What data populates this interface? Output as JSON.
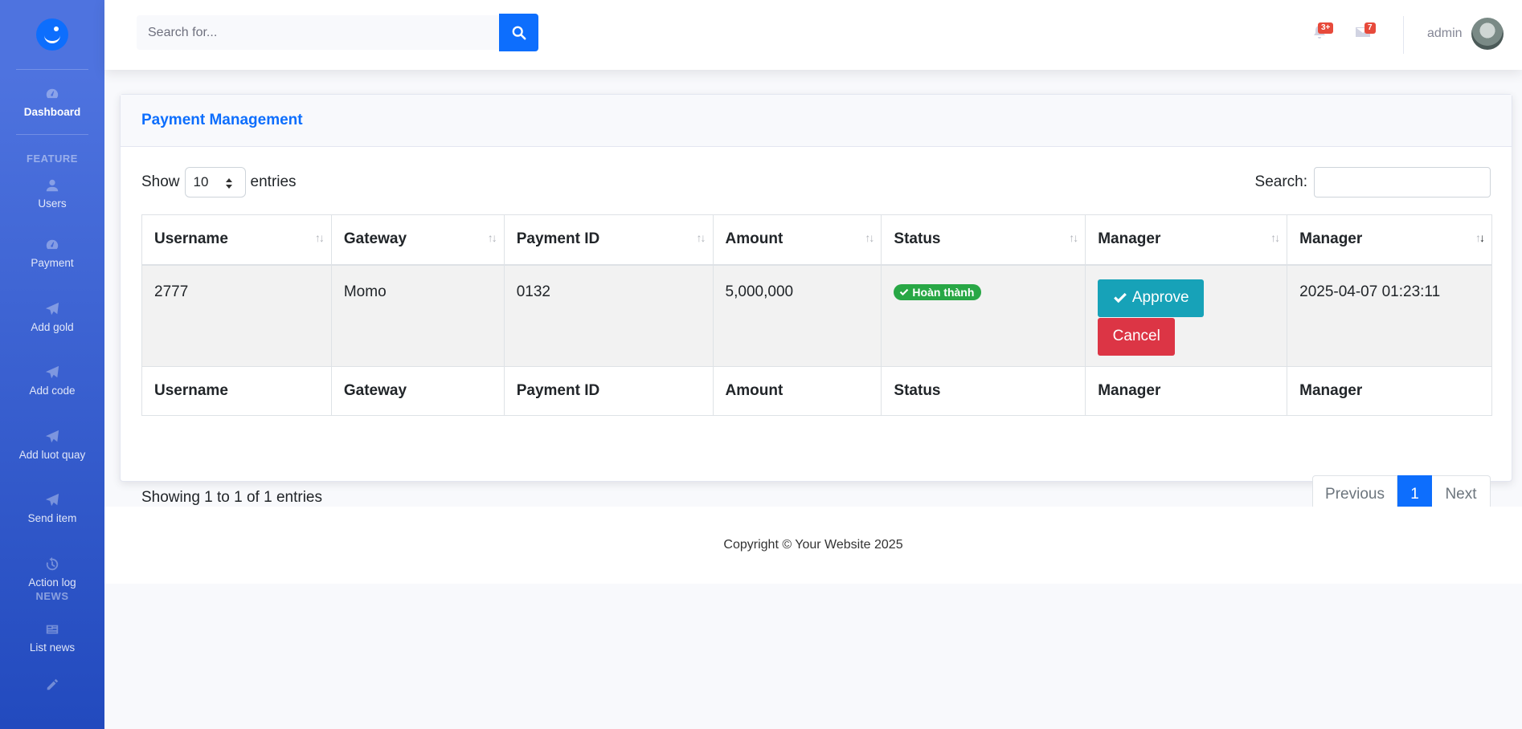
{
  "sidebar": {
    "brand_icon": "smile-logo-icon",
    "items": [
      {
        "label": "Dashboard",
        "icon": "tachometer-icon"
      },
      {
        "label": "Users",
        "icon": "user-icon"
      },
      {
        "label": "Payment",
        "icon": "tachometer-icon"
      },
      {
        "label": "Add gold",
        "icon": "paper-plane-icon"
      },
      {
        "label": "Add code",
        "icon": "paper-plane-icon"
      },
      {
        "label": "Add luot quay",
        "icon": "paper-plane-icon"
      },
      {
        "label": "Send item",
        "icon": "paper-plane-icon"
      },
      {
        "label": "Action log",
        "icon": "history-icon"
      },
      {
        "label": "List news",
        "icon": "newspaper-icon"
      }
    ],
    "headings": {
      "feature": "FEATURE",
      "news": "NEWS"
    }
  },
  "topbar": {
    "search_placeholder": "Search for...",
    "alerts_count": "3+",
    "messages_count": "7",
    "user_name": "admin"
  },
  "card": {
    "title": "Payment Management",
    "show_label": "Show",
    "entries_value": "10",
    "entries_label": "entries",
    "search_label": "Search:",
    "columns": [
      "Username",
      "Gateway",
      "Payment ID",
      "Amount",
      "Status",
      "Manager",
      "Manager"
    ],
    "rows": [
      {
        "username": "2777",
        "gateway": "Momo",
        "payment_id": "0132",
        "amount": "5,000,000",
        "status": "Hoàn thành",
        "approve_label": "Approve",
        "cancel_label": "Cancel",
        "date": "2025-04-07 01:23:11"
      }
    ],
    "info": "Showing 1 to 1 of 1 entries",
    "pagination": {
      "previous": "Previous",
      "current": "1",
      "next": "Next"
    }
  },
  "footer": {
    "copyright": "Copyright © Your Website 2025"
  },
  "colors": {
    "primary": "#0d6efd",
    "sidebar_start": "#4e73df",
    "sidebar_end": "#224abe",
    "success": "#28a745",
    "info": "#17a2b8",
    "danger": "#dc3545"
  }
}
